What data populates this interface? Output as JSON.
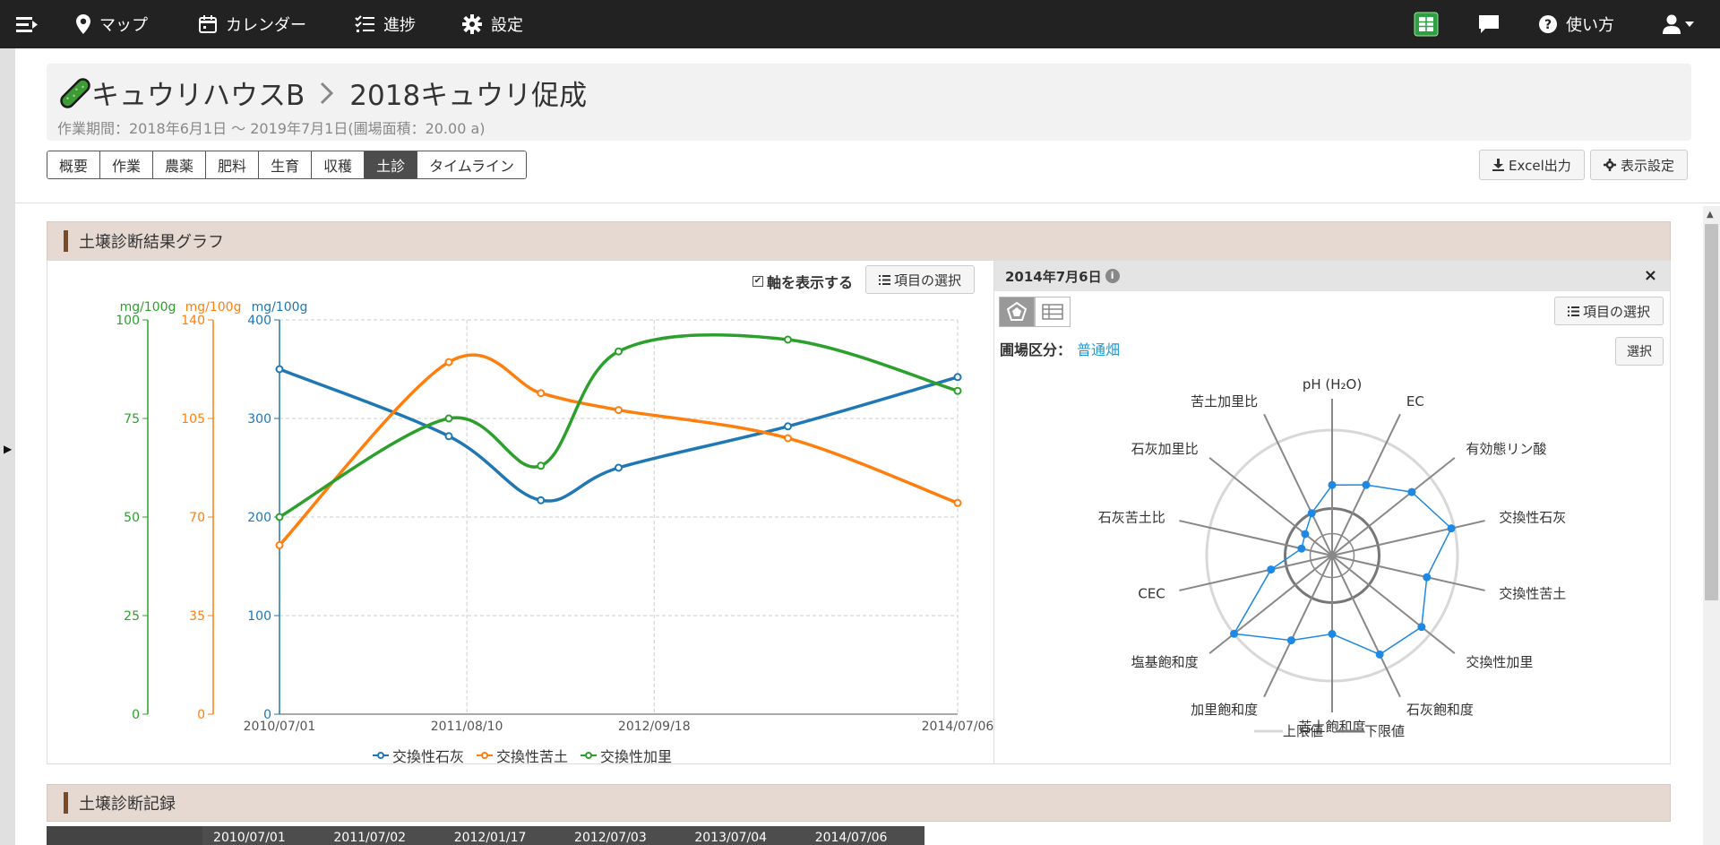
{
  "nav": {
    "items": [
      {
        "label": "マップ",
        "icon": "map-pin-icon"
      },
      {
        "label": "カレンダー",
        "icon": "calendar-icon"
      },
      {
        "label": "進捗",
        "icon": "checklist-icon"
      },
      {
        "label": "設定",
        "icon": "gear-icon"
      }
    ],
    "help_label": "使い方"
  },
  "header": {
    "house": "キュウリハウスB",
    "crop": "2018キュウリ促成",
    "period": "作業期間：2018年6月1日 〜 2019年7月1日(圃場面積：20.00 a)"
  },
  "tabs": [
    "概要",
    "作業",
    "農薬",
    "肥料",
    "生育",
    "収穫",
    "土診",
    "タイムライン"
  ],
  "active_tab": "土診",
  "toolbar": {
    "excel_label": "Excel出力",
    "display_settings_label": "表示設定"
  },
  "graph_section": {
    "title": "土壌診断結果グラフ",
    "show_axis_label": "軸を表示する",
    "select_items_label": "項目の選択"
  },
  "radar_panel": {
    "date": "2014年7月6日",
    "info_glyph": "i",
    "close_glyph": "×",
    "select_items_label": "項目の選択",
    "field_type_label": "圃場区分：",
    "field_type_value": "普通畑",
    "select_label": "選択"
  },
  "records_section": {
    "title": "土壌診断記録",
    "columns": [
      "2010/07/01",
      "2011/07/02",
      "2012/01/17",
      "2012/07/03",
      "2013/07/04",
      "2014/07/06"
    ]
  },
  "colors": {
    "blue": "#1f77b4",
    "orange": "#ff7f0e",
    "green": "#2ca02c",
    "radar": "#1e88e5"
  },
  "chart_data": [
    {
      "type": "line",
      "x": [
        "2010/07/01",
        "2011/07/02",
        "2012/01/17",
        "2012/07/03",
        "2013/07/04",
        "2014/07/06"
      ],
      "x_ticks": [
        "2010/07/01",
        "2011/08/10",
        "2012/09/18",
        "2014/07/06"
      ],
      "series": [
        {
          "name": "交換性石灰",
          "axis": "left3",
          "color": "#1f77b4",
          "values": [
            350,
            282,
            217,
            250,
            292,
            342
          ]
        },
        {
          "name": "交換性苦土",
          "axis": "left2",
          "color": "#ff7f0e",
          "values": [
            60,
            125,
            114,
            108,
            98,
            75
          ]
        },
        {
          "name": "交換性加里",
          "axis": "left1",
          "color": "#2ca02c",
          "values": [
            50,
            75,
            63,
            92,
            95,
            82
          ]
        }
      ],
      "axes": [
        {
          "id": "left1",
          "unit": "mg/100g",
          "range": [
            0,
            100
          ],
          "ticks": [
            0,
            25,
            50,
            75,
            100
          ],
          "color": "#2ca02c"
        },
        {
          "id": "left2",
          "unit": "mg/100g",
          "range": [
            0,
            140
          ],
          "ticks": [
            0,
            35,
            70,
            105,
            140
          ],
          "color": "#ff7f0e"
        },
        {
          "id": "left3",
          "unit": "mg/100g",
          "range": [
            0,
            400
          ],
          "ticks": [
            0,
            100,
            200,
            300,
            400
          ],
          "color": "#1f77b4"
        }
      ],
      "grid": true,
      "legend": "bottom"
    },
    {
      "type": "radar",
      "axes": [
        "pH (H₂O)",
        "EC",
        "有効態リン酸",
        "交換性石灰",
        "交換性苦土",
        "交換性加里",
        "石灰飽和度",
        "苦土飽和度",
        "加里飽和度",
        "塩基飽和度",
        "CEC",
        "石灰苦土比",
        "石灰加里比",
        "苦土加里比"
      ],
      "values": [
        0.45,
        0.5,
        0.65,
        0.78,
        0.62,
        0.73,
        0.7,
        0.5,
        0.6,
        0.8,
        0.4,
        0.2,
        0.22,
        0.3
      ],
      "upper_limit_value": 0.8,
      "lower_limit_value": 0.3,
      "legend": [
        "上限値",
        "下限値"
      ]
    }
  ]
}
